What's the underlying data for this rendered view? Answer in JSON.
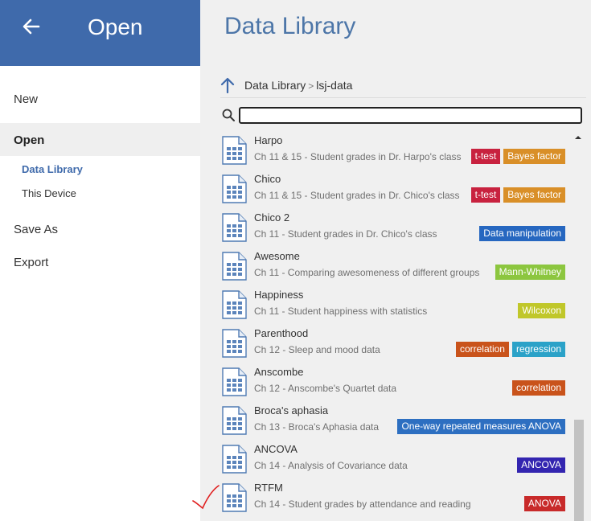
{
  "nav": {
    "title": "Open",
    "items": {
      "new": "New",
      "open": "Open",
      "data_library": "Data Library",
      "this_device": "This Device",
      "save_as": "Save As",
      "export": "Export"
    }
  },
  "main": {
    "title": "Data Library",
    "breadcrumb": [
      "Data Library",
      "lsj-data"
    ],
    "breadcrumb_separator": ">",
    "search": {
      "value": "",
      "placeholder": ""
    }
  },
  "colors": {
    "header_blue": "#3f6aab",
    "t-test": "#c8223f",
    "bayes": "#d98f28",
    "data_manipulation": "#2667c0",
    "mann_whitney": "#8cc63f",
    "wilcoxon": "#c0c72a",
    "correlation": "#c9531b",
    "regression": "#2ba2c8",
    "anova_rm": "#2d6fc1",
    "ancova": "#3325b0",
    "anova": "#c82a2a"
  },
  "files": [
    {
      "name": "Harpo",
      "desc": "Ch 11 & 15 - Student grades in Dr. Harpo's class",
      "tags": [
        {
          "label": "t-test",
          "color": "#c8223f"
        },
        {
          "label": "Bayes factor",
          "color": "#d98f28"
        }
      ]
    },
    {
      "name": "Chico",
      "desc": "Ch 11 & 15 - Student grades in Dr. Chico's class",
      "tags": [
        {
          "label": "t-test",
          "color": "#c8223f"
        },
        {
          "label": "Bayes factor",
          "color": "#d98f28"
        }
      ]
    },
    {
      "name": "Chico 2",
      "desc": "Ch 11 - Student grades in Dr. Chico's class",
      "tags": [
        {
          "label": "Data manipulation",
          "color": "#2667c0"
        }
      ]
    },
    {
      "name": "Awesome",
      "desc": "Ch 11 - Comparing awesomeness of different groups",
      "tags": [
        {
          "label": "Mann-Whitney",
          "color": "#8cc63f"
        }
      ]
    },
    {
      "name": "Happiness",
      "desc": "Ch 11 - Student happiness with statistics",
      "tags": [
        {
          "label": "Wilcoxon",
          "color": "#c0c72a"
        }
      ]
    },
    {
      "name": "Parenthood",
      "desc": "Ch 12 - Sleep and mood data",
      "tags": [
        {
          "label": "correlation",
          "color": "#c9531b"
        },
        {
          "label": "regression",
          "color": "#2ba2c8"
        }
      ]
    },
    {
      "name": "Anscombe",
      "desc": "Ch 12 - Anscombe's Quartet data",
      "tags": [
        {
          "label": "correlation",
          "color": "#c9531b"
        }
      ]
    },
    {
      "name": "Broca's aphasia",
      "desc": "Ch 13 - Broca's Aphasia data",
      "tags": [
        {
          "label": "One-way repeated measures ANOVA",
          "color": "#2d6fc1"
        }
      ]
    },
    {
      "name": "ANCOVA",
      "desc": "Ch 14 - Analysis of Covariance data",
      "tags": [
        {
          "label": "ANCOVA",
          "color": "#3325b0"
        }
      ]
    },
    {
      "name": "RTFM",
      "desc": "Ch 14 - Student grades by attendance and reading",
      "tags": [
        {
          "label": "ANOVA",
          "color": "#c82a2a"
        }
      ]
    }
  ]
}
